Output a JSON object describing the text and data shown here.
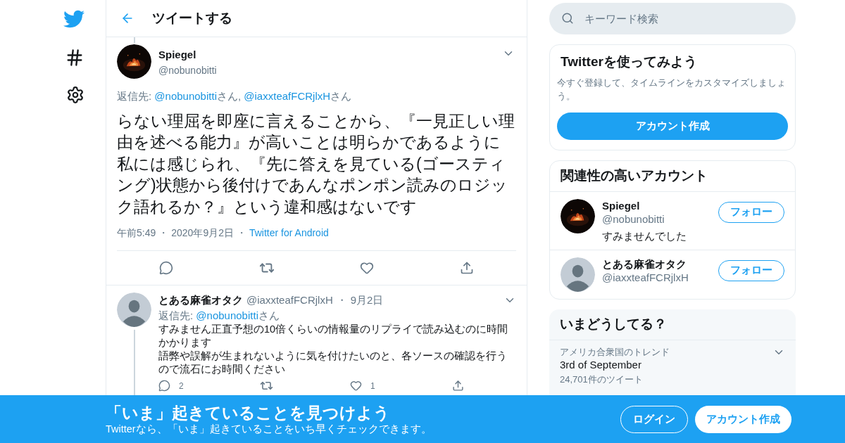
{
  "header": {
    "title": "ツイートする"
  },
  "tweet": {
    "name": "Spiegel",
    "handle": "@nobunobitti",
    "reply_to": [
      {
        "text": "返信先: ",
        "link": false
      },
      {
        "text": "@nobunobitti",
        "link": true
      },
      {
        "text": "さん, ",
        "link": false
      },
      {
        "text": "@iaxxteafFCRjlxH",
        "link": true
      },
      {
        "text": "さん",
        "link": false
      }
    ],
    "text": "らない理屈を即座に言えることから、『一見正しい理由を述べる能力』が高いことは明らかであるように私には感じられ、『先に答えを見ている(ゴースティング)状態から後付けであんなポンポン読みのロジック語れるか？』という違和感はないです",
    "meta": [
      {
        "text": "午前5:49",
        "kind": "time"
      },
      {
        "text": "・",
        "kind": "dot"
      },
      {
        "text": "2020年9月2日",
        "kind": "date"
      },
      {
        "text": "・",
        "kind": "dot"
      },
      {
        "text": "Twitter for Android",
        "kind": "link"
      }
    ]
  },
  "reply": {
    "name": "とある麻雀オタク",
    "handle": "@iaxxteafFCRjlxH",
    "separator": "・",
    "date": "9月2日",
    "reply_to": [
      {
        "text": "返信先: ",
        "link": false
      },
      {
        "text": "@nobunobitti",
        "link": true
      },
      {
        "text": "さん",
        "link": false
      }
    ],
    "paragraphs": [
      "すみません正直予想の10倍くらいの情報量のリプライで読み込むのに時間かかります",
      "語弊や誤解が生まれないように気を付けたいのと、各ソースの確認を行うので流石にお時間ください"
    ],
    "replies": "2",
    "likes": "1"
  },
  "search": {
    "placeholder": "キーワード検索"
  },
  "signup_card": {
    "title": "Twitterを使ってみよう",
    "text": "今すぐ登録して、タイムラインをカスタマイズしましょう。",
    "button": "アカウント作成"
  },
  "related": {
    "title": "関連性の高いアカウント",
    "accounts": [
      {
        "name": "Spiegel",
        "handle": "@nobunobitti",
        "bio": "すみませんでした",
        "button": "フォロー"
      },
      {
        "name": "とある麻雀オタク",
        "handle": "@iaxxteafFCRjlxH",
        "button": "フォロー",
        "avatar": {
          "kind": "silhouette"
        }
      }
    ]
  },
  "trends": {
    "title": "いまどうしてる？",
    "items": [
      {
        "context": "アメリカ合衆国のトレンド",
        "name": "3rd of September",
        "count": "24,701件のツイート"
      }
    ]
  },
  "banner": {
    "title": "「いま」起きていることを見つけよう",
    "subtitle": "Twitterなら、「いま」起きていることをいち早くチェックできます。",
    "login": "ログイン",
    "signup": "アカウント作成"
  }
}
